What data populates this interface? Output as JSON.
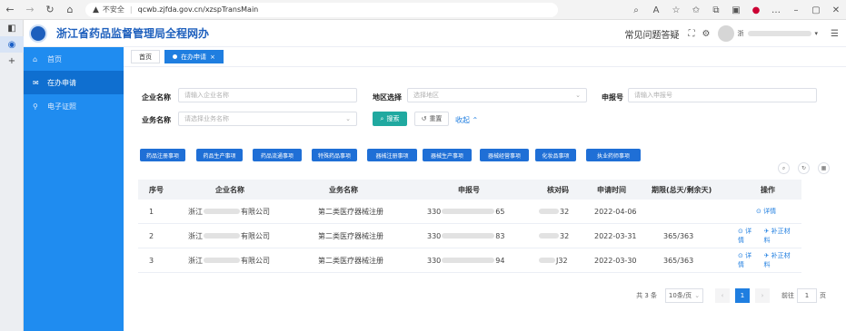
{
  "browser": {
    "url": "qcwb.zjfda.gov.cn/xzspTransMain",
    "insecure_label": "不安全"
  },
  "header": {
    "title": "浙江省药品监督管理局全程网办",
    "faq": "常见问题答疑",
    "user_prefix": "浙"
  },
  "sidebar": {
    "items": [
      {
        "label": "首页",
        "icon": "home-icon"
      },
      {
        "label": "在办申请",
        "icon": "apply-icon"
      },
      {
        "label": "电子证照",
        "icon": "certificate-icon"
      }
    ]
  },
  "tabs": {
    "home": "首页",
    "active": "在办申请"
  },
  "form": {
    "company_label": "企业名称",
    "company_placeholder": "请输入企业名称",
    "region_label": "地区选择",
    "region_placeholder": "选择地区",
    "apply_no_label": "申报号",
    "apply_no_placeholder": "请输入申报号",
    "business_label": "业务名称",
    "business_placeholder": "请选择业务名称",
    "search_button": "搜索",
    "reset_button": "重置",
    "collapse": "收起"
  },
  "categories": [
    "药品注册事项",
    "药品生产事项",
    "药品流通事项",
    "特殊药品事项",
    "器械注册事项",
    "器械生产事项",
    "器械经营事项",
    "化妆品事项",
    "执业药师事项"
  ],
  "table": {
    "headers": [
      "序号",
      "企业名称",
      "业务名称",
      "申报号",
      "核对码",
      "申请时间",
      "期限(总天/剩余天)",
      "操作"
    ],
    "rows": [
      {
        "index": "1",
        "company_start": "浙江",
        "company_end": "有限公司",
        "business": "第二类医疗器械注册",
        "apply_start": "330",
        "apply_end": "65",
        "check_end": "32",
        "date": "2022-04-06",
        "deadline": "",
        "detail": "详情",
        "supplement": ""
      },
      {
        "index": "2",
        "company_start": "浙江",
        "company_end": "有限公司",
        "business": "第二类医疗器械注册",
        "apply_start": "330",
        "apply_end": "83",
        "check_end": "32",
        "date": "2022-03-31",
        "deadline": "365/363",
        "detail": "详情",
        "supplement": "补正材料"
      },
      {
        "index": "3",
        "company_start": "浙江",
        "company_end": "有限公司",
        "business": "第二类医疗器械注册",
        "apply_start": "330",
        "apply_end": "94",
        "check_end": "J32",
        "date": "2022-03-30",
        "deadline": "365/363",
        "detail": "详情",
        "supplement": "补正材料"
      }
    ]
  },
  "pagination": {
    "total": "共 3 条",
    "page_size": "10条/页",
    "current_page": "1",
    "goto_prefix": "前往",
    "goto_value": "1",
    "goto_suffix": "页"
  }
}
